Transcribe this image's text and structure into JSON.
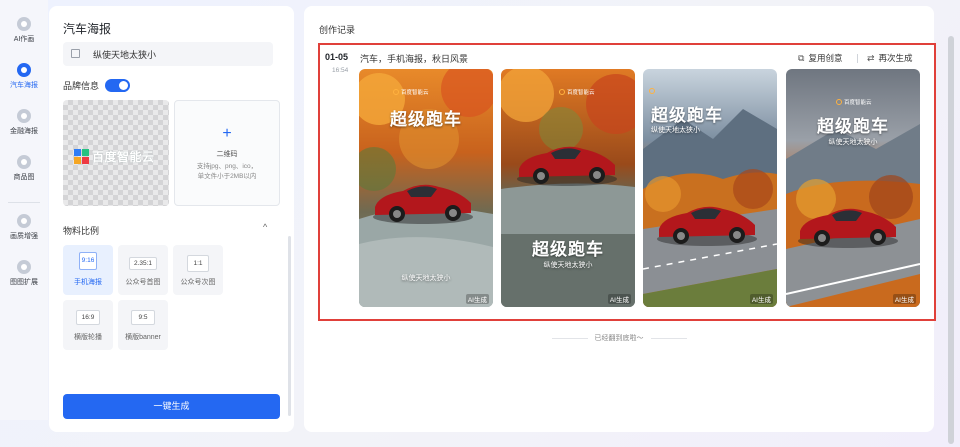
{
  "nav": {
    "items": [
      {
        "label": "AI作画",
        "active": false
      },
      {
        "label": "汽车海报",
        "active": true
      },
      {
        "label": "金融海报",
        "active": false
      },
      {
        "label": "商品图",
        "active": false
      },
      {
        "label": "画质增强",
        "active": false
      },
      {
        "label": "图图扩展",
        "active": false
      }
    ]
  },
  "left_panel": {
    "title": "汽车海报",
    "slogan_value": "纵使天地太狭小",
    "brand_label": "品牌信息",
    "brand_toggle_on": true,
    "logo_text": "百度智能云",
    "qr": {
      "plus": "+",
      "title": "二维码",
      "desc_line1": "支持jpg、png、ico，",
      "desc_line2": "单文件小于2MB以内"
    },
    "ratio_heading": "物料比例",
    "ratio_chevron": "^",
    "ratios": [
      {
        "value": "9:16",
        "label": "手机海报",
        "active": true
      },
      {
        "value": "2.35:1",
        "label": "公众号首图",
        "active": false
      },
      {
        "value": "1:1",
        "label": "公众号次图",
        "active": false
      },
      {
        "value": "16:9",
        "label": "横版轮播",
        "active": false
      },
      {
        "value": "9:5",
        "label": "横版banner",
        "active": false
      }
    ],
    "generate_button": "一键生成"
  },
  "main": {
    "title": "创作记录",
    "record": {
      "date": "01-05",
      "time": "16:54",
      "description": "汽车，手机海报，秋日风景",
      "reuse_label": "复用创意",
      "regenerate_label": "再次生成",
      "reuse_icon": "copy-icon",
      "regenerate_icon": "refresh-icon"
    },
    "posters": [
      {
        "headline": "超级跑车",
        "sub": "纵使天地太狭小",
        "brand": "百度智能云",
        "badge": "AI生成"
      },
      {
        "headline": "超级跑车",
        "sub": "纵使天地太狭小",
        "brand": "百度智能云",
        "badge": "AI生成"
      },
      {
        "headline": "超级跑车",
        "sub": "纵使天地太狭小",
        "brand": "",
        "badge": "AI生成"
      },
      {
        "headline": "超级跑车",
        "sub": "纵使天地太狭小",
        "brand": "百度智能云",
        "badge": "AI生成"
      }
    ],
    "bottom_note": "已经翻到底啦～"
  },
  "colors": {
    "accent": "#2468f2",
    "highlight_border": "#e0403a",
    "car_red": "#b3171c"
  }
}
